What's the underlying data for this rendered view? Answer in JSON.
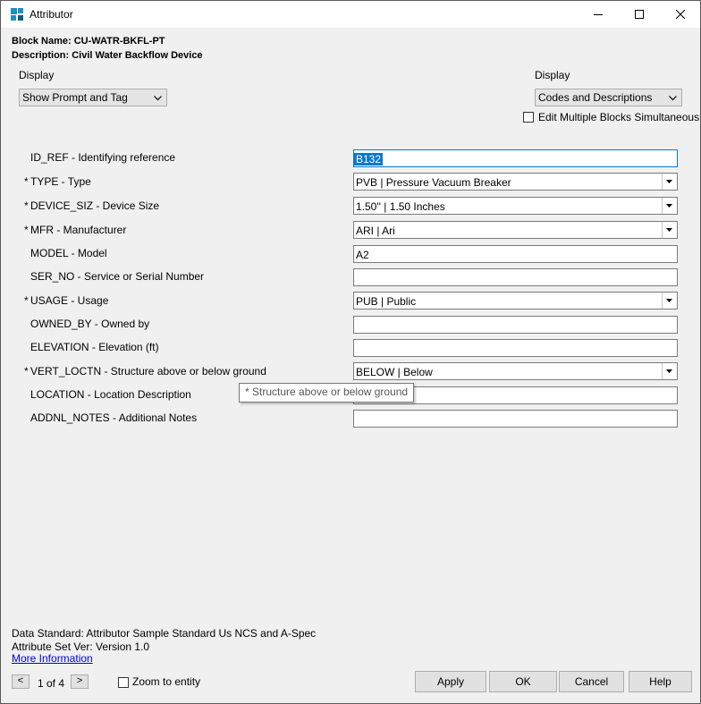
{
  "window": {
    "title": "Attributor"
  },
  "header": {
    "block_name_label": "Block Name: ",
    "block_name": "CU-WATR-BKFL-PT",
    "description_label": "Description: ",
    "description": "Civil Water Backflow Device"
  },
  "display_left": {
    "label": "Display",
    "value": "Show Prompt and Tag"
  },
  "display_right": {
    "label": "Display",
    "value": "Codes and Descriptions"
  },
  "edit_multiple": {
    "label": "Edit Multiple Blocks Simultaneously",
    "checked": false
  },
  "attributes": [
    {
      "label": "ID_REF - Identifying reference",
      "required": false,
      "value": "B132",
      "selected": true,
      "dropdown": false
    },
    {
      "label": "TYPE - Type",
      "required": true,
      "value": "PVB | Pressure Vacuum Breaker",
      "dropdown": true
    },
    {
      "label": "DEVICE_SIZ - Device Size",
      "required": true,
      "value": "1.50'' | 1.50 Inches",
      "dropdown": true
    },
    {
      "label": "MFR - Manufacturer",
      "required": true,
      "value": "ARI | Ari",
      "dropdown": true
    },
    {
      "label": "MODEL - Model",
      "required": false,
      "value": "A2",
      "dropdown": false
    },
    {
      "label": "SER_NO - Service or Serial Number",
      "required": false,
      "value": "",
      "dropdown": false
    },
    {
      "label": "USAGE - Usage",
      "required": true,
      "value": "PUB | Public",
      "dropdown": true
    },
    {
      "label": "OWNED_BY - Owned by",
      "required": false,
      "value": "",
      "dropdown": false
    },
    {
      "label": "ELEVATION - Elevation (ft)",
      "required": false,
      "value": "",
      "dropdown": false
    },
    {
      "label": "VERT_LOCTN - Structure above or below ground",
      "required": true,
      "value": "BELOW | Below",
      "dropdown": true
    },
    {
      "label": "LOCATION - Location Description",
      "required": false,
      "value": "",
      "dropdown": false
    },
    {
      "label": "ADDNL_NOTES - Additional Notes",
      "required": false,
      "value": "",
      "dropdown": false
    }
  ],
  "required_marker": "*",
  "tooltip": {
    "text": "* Structure above or below ground"
  },
  "footer": {
    "data_standard": "Data Standard: Attributor Sample Standard Us NCS and A-Spec",
    "attribute_set": "Attribute Set Ver: Version 1.0",
    "more_info": "More Information",
    "prev": "<",
    "page": "1 of 4",
    "next": ">",
    "zoom_label": "Zoom to entity"
  },
  "buttons": {
    "apply": "Apply",
    "ok": "OK",
    "cancel": "Cancel",
    "help": "Help"
  }
}
